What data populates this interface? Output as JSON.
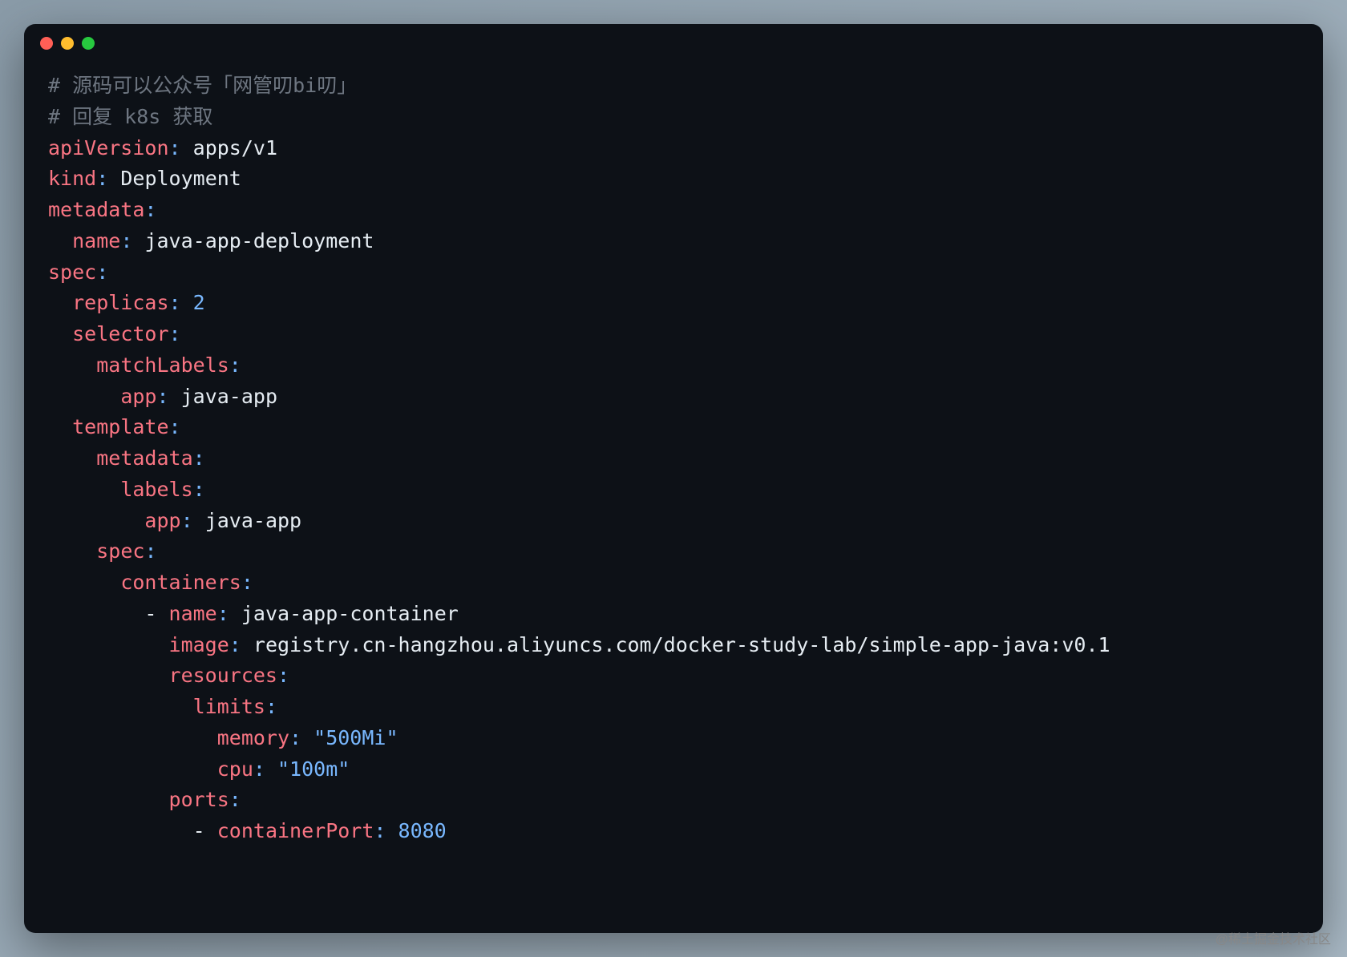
{
  "titlebar": {
    "buttons": [
      "close",
      "minimize",
      "maximize"
    ]
  },
  "code": {
    "comment1_prefix": "# ",
    "comment1": "源码可以公众号「网管叨bi叨」",
    "comment2_prefix": "# ",
    "comment2": "回复 k8s 获取",
    "apiVersion_key": "apiVersion",
    "apiVersion_val": "apps/v1",
    "kind_key": "kind",
    "kind_val": "Deployment",
    "metadata_key": "metadata",
    "name_key": "name",
    "name_val": "java-app-deployment",
    "spec_key": "spec",
    "replicas_key": "replicas",
    "replicas_val": "2",
    "selector_key": "selector",
    "matchLabels_key": "matchLabels",
    "app_key": "app",
    "app_val": "java-app",
    "template_key": "template",
    "labels_key": "labels",
    "containers_key": "containers",
    "container_name_key": "name",
    "container_name_val": "java-app-container",
    "image_key": "image",
    "image_val": "registry.cn-hangzhou.aliyuncs.com/docker-study-lab/simple-app-java:v0.1",
    "resources_key": "resources",
    "limits_key": "limits",
    "memory_key": "memory",
    "memory_val": "\"500Mi\"",
    "cpu_key": "cpu",
    "cpu_val": "\"100m\"",
    "ports_key": "ports",
    "containerPort_key": "containerPort",
    "containerPort_val": "8080",
    "colon": ":",
    "dash": "- "
  },
  "watermark": "@稀土掘金技术社区"
}
